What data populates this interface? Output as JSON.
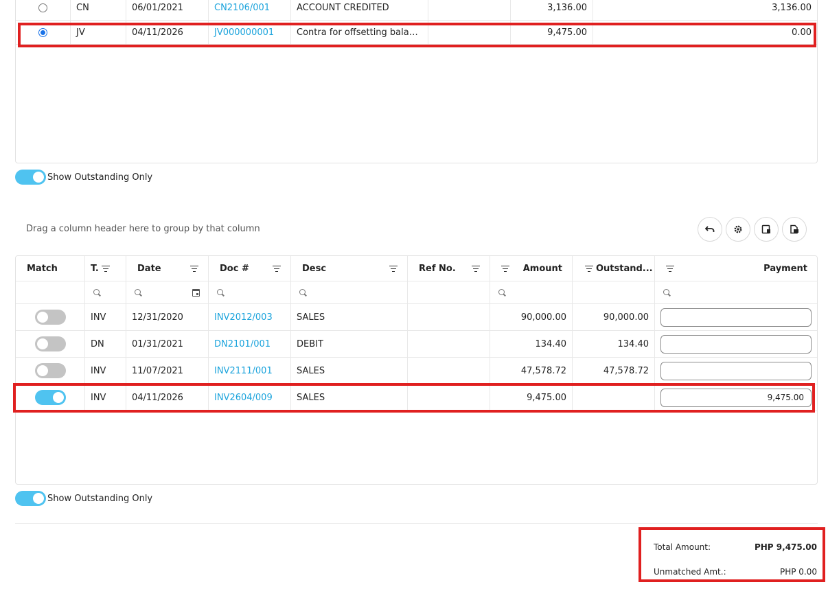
{
  "top_grid": {
    "rows": [
      {
        "selected": false,
        "type": "CN",
        "date": "06/01/2021",
        "doc": "CN2106/001",
        "desc": "ACCOUNT CREDITED",
        "ref": "",
        "amount": "3,136.00",
        "outstanding": "3,136.00"
      },
      {
        "selected": true,
        "type": "JV",
        "date": "04/11/2026",
        "doc": "JV000000001",
        "desc": "Contra for offsetting balan...",
        "ref": "",
        "amount": "9,475.00",
        "outstanding": "0.00"
      }
    ]
  },
  "show_outstanding_label": "Show Outstanding Only",
  "drag_hint": "Drag a column header here to group by that column",
  "toolbar": {
    "undo_icon": "undo-icon",
    "settings_icon": "gear-icon",
    "layout_icon": "column-chooser-icon",
    "export_icon": "export-icon"
  },
  "bottom_grid": {
    "headers": {
      "match": "Match",
      "type": "T.",
      "date": "Date",
      "doc": "Doc #",
      "desc": "Desc",
      "ref": "Ref No.",
      "amount": "Amount",
      "outstanding": "Outstand...",
      "payment": "Payment"
    },
    "rows": [
      {
        "matched": false,
        "type": "INV",
        "date": "12/31/2020",
        "doc": "INV2012/003",
        "desc": "SALES",
        "ref": "",
        "amount": "90,000.00",
        "outstanding": "90,000.00",
        "payment": ""
      },
      {
        "matched": false,
        "type": "DN",
        "date": "01/31/2021",
        "doc": "DN2101/001",
        "desc": "DEBIT",
        "ref": "",
        "amount": "134.40",
        "outstanding": "134.40",
        "payment": ""
      },
      {
        "matched": false,
        "type": "INV",
        "date": "11/07/2021",
        "doc": "INV2111/001",
        "desc": "SALES",
        "ref": "",
        "amount": "47,578.72",
        "outstanding": "47,578.72",
        "payment": ""
      },
      {
        "matched": true,
        "type": "INV",
        "date": "04/11/2026",
        "doc": "INV2604/009",
        "desc": "SALES",
        "ref": "",
        "amount": "9,475.00",
        "outstanding": "",
        "payment": "9,475.00"
      }
    ]
  },
  "totals": {
    "total_label": "Total Amount:",
    "total_value": "PHP 9,475.00",
    "unmatched_label": "Unmatched Amt.:",
    "unmatched_value": "PHP 0.00"
  },
  "colors": {
    "accent": "#1aa3dc",
    "toggle_on": "#4fc3f0",
    "highlight": "#e02020"
  }
}
